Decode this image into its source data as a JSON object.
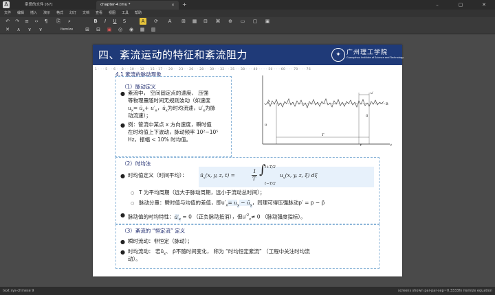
{
  "window": {
    "app_tab": "亲爱的文件 [67]",
    "doc_tab": "chapter-4.tmu *",
    "tab_close": "×",
    "new_tab": "+",
    "minimize": "–",
    "maximize": "▢",
    "close": "✕"
  },
  "menu": [
    "文件",
    "编辑",
    "插入",
    "演示",
    "格式",
    "幻灯",
    "文档",
    "查看",
    "视图",
    "工具",
    "帮助"
  ],
  "toolbar1": {
    "icons": [
      "↶",
      "↷",
      "≡",
      "‹›",
      "¶",
      "⎘",
      "⌕",
      "B",
      "I",
      "U",
      "S",
      "A",
      "⟳",
      "A",
      "⊞",
      "▦",
      "⊟",
      "⌘",
      "⊕",
      "▭",
      "▢",
      "▣"
    ]
  },
  "toolbar2": {
    "icons_left": [
      "✕",
      "∧",
      "∨",
      "∨"
    ],
    "itemize_label": "itemize",
    "icons_right": [
      "⊞",
      "⊟",
      "▣",
      "◎",
      "◉",
      "▦",
      "▥"
    ]
  },
  "slide": {
    "title": "四、紊流运动的特征和紊流阻力",
    "logo_text": "广州理工学院",
    "logo_sub": "Guangzhou Institute of Science and Technology",
    "ruler": "1 · · · 5 · · 6 · · 8 · · 10 · · 12 · · 15 · 17 · · 20 · · 23 · · 26 · · 28 · · 30 · · 32 · · 35 · · 38 · · · 40 · · · · 50 · · · 60 · · · 70 · · · 76",
    "section1_title": "4.1  紊流的脉动现象",
    "sub1": "（1）脉动定义",
    "p1_l1": "紊流中，   空间固定点的速度、   压强",
    "p1_l2": "等物理量随时间无规则波动（如速度",
    "p1_l3_a": "u",
    "p1_l3_b": "= ū",
    "p1_l3_c": "+ u′",
    "p1_l3_d": "，ū",
    "p1_l3_e": "为时均流速，u′",
    "p1_l3_f": "为脉",
    "p1_l4": "动流速）；",
    "p2_l1": "例：管流中某点  x  方向速度，瞬时值",
    "p2_l2": "在时均值上下波动，脉动频率  10²~10⁵",
    "p2_l3": "Hz，振幅  < 10%  时均值。",
    "sub2": "（2）时均法",
    "tavg_label": "时均值定义（时间平均）：",
    "tavg_formula": "ū",
    "tavg_formula2": "(x, y, z, t) =",
    "tavg_frac_top": "1",
    "tavg_frac_bot": "T",
    "tavg_upper": "t+T/2",
    "tavg_lower": "t−T/2",
    "tavg_integrand": "u",
    "tavg_integrand2": "(x, y, z, ξ) dξ",
    "h1": "T  为平均周期（远大于脉动周期，远小于流动总时间）；",
    "h2_a": "脉动分量：瞬时值与均值的差值，即u′",
    "h2_b": "= u",
    "h2_c": " − ū",
    "h2_d": "，同理可得压强脉动p′ = p − p̄",
    "p3_a": "脉动值的时均特性：",
    "p3_b": "ū′",
    "p3_c": " = 0 （正负脉动抵消），但u′",
    "p3_d": "≠ 0 （脉动强度指标）。",
    "sub3": "（3）紊流的 “恒定流” 定义",
    "p4": "瞬时流动：非恒定（脉动）；",
    "p5_l1": "时均流动：   若ū",
    "p5_l1b": "、 p̄不随时间变化，  称为  “时均恒定紊流”  （工程中关注时均流",
    "p5_l2": "动）。",
    "fig_labels": {
      "a": "A",
      "b": "B",
      "u": "u",
      "u_bar": "ū",
      "t": "t",
      "T": "T",
      "t_prime": "t′",
      "u_prime": "u′"
    }
  },
  "status": {
    "left": "text sys-chinese 9",
    "right": "screens shown par-par-sep~0.3333fn itemize equation"
  }
}
